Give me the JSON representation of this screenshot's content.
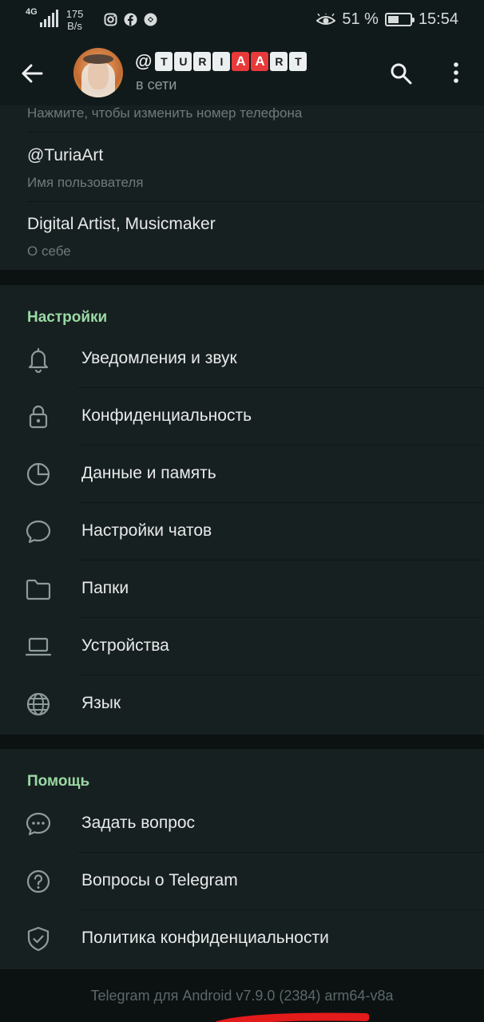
{
  "status_bar": {
    "network": "4G",
    "speed_value": "175",
    "speed_unit": "B/s",
    "app_icons": [
      "instagram-icon",
      "facebook-icon",
      "game-icon"
    ],
    "battery_percent": "51 %",
    "battery_level": 0.51,
    "time": "15:54"
  },
  "header": {
    "title_prefix": "@",
    "title_tiles": [
      "T",
      "U",
      "R",
      "I",
      "A",
      "A",
      "R",
      "T"
    ],
    "status": "в сети"
  },
  "profile": {
    "phone_hint": "Нажмите, чтобы изменить номер телефона",
    "username": "@TuriaArt",
    "username_label": "Имя пользователя",
    "bio": "Digital Artist, Musicmaker",
    "bio_label": "О себе"
  },
  "settings": {
    "title": "Настройки",
    "items": [
      {
        "label": "Уведомления и звук",
        "icon": "bell-icon"
      },
      {
        "label": "Конфиденциальность",
        "icon": "lock-icon"
      },
      {
        "label": "Данные и память",
        "icon": "pie-chart-icon"
      },
      {
        "label": "Настройки чатов",
        "icon": "chat-bubble-icon"
      },
      {
        "label": "Папки",
        "icon": "folder-icon"
      },
      {
        "label": "Устройства",
        "icon": "laptop-icon"
      },
      {
        "label": "Язык",
        "icon": "globe-icon"
      }
    ]
  },
  "help": {
    "title": "Помощь",
    "items": [
      {
        "label": "Задать вопрос",
        "icon": "chat-dots-icon"
      },
      {
        "label": "Вопросы о Telegram",
        "icon": "question-circle-icon"
      },
      {
        "label": "Политика конфиденциальности",
        "icon": "shield-check-icon"
      }
    ]
  },
  "footer": {
    "version": "Telegram для Android v7.9.0 (2384) arm64-v8a"
  },
  "colors": {
    "accent_green": "#9ad9a4",
    "panel": "#172021",
    "background": "#0c1112",
    "tile_red": "#e83a3a",
    "scribble_red": "#e31b1b"
  }
}
